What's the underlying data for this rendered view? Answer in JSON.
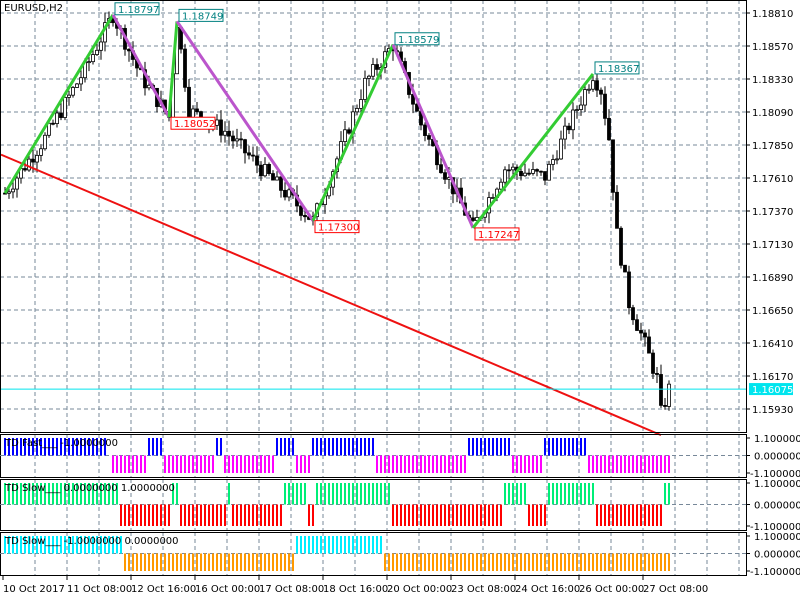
{
  "chart_data": {
    "type": "candlestick",
    "title": "EURUSD,H2",
    "price_ticks": [
      "1.18810",
      "1.18570",
      "1.18330",
      "1.18090",
      "1.17850",
      "1.17610",
      "1.17370",
      "1.17130",
      "1.16890",
      "1.16650",
      "1.16410",
      "1.16170",
      "1.15930"
    ],
    "price_range": [
      1.1562,
      1.1893
    ],
    "current_price": "1.16075",
    "time_labels": [
      "10 Oct 2017",
      "11 Oct 08:00",
      "12 Oct 16:00",
      "16 Oct 00:00",
      "17 Oct 08:00",
      "18 Oct 16:00",
      "20 Oct 00:00",
      "23 Oct 08:00",
      "24 Oct 16:00",
      "26 Oct 00:00",
      "27 Oct 08:00"
    ],
    "bar_count": 167,
    "price_path": [
      [
        0,
        1.175
      ],
      [
        10,
        1.179
      ],
      [
        20,
        1.184
      ],
      [
        27,
        1.18797
      ],
      [
        34,
        1.1835
      ],
      [
        41,
        1.18052
      ],
      [
        43,
        1.18749
      ],
      [
        46,
        1.181
      ],
      [
        55,
        1.1795
      ],
      [
        65,
        1.1765
      ],
      [
        77,
        1.173
      ],
      [
        83,
        1.1775
      ],
      [
        90,
        1.183
      ],
      [
        97,
        1.18579
      ],
      [
        104,
        1.18
      ],
      [
        110,
        1.1765
      ],
      [
        117,
        1.17247
      ],
      [
        125,
        1.1768
      ],
      [
        135,
        1.1762
      ],
      [
        147,
        1.18367
      ],
      [
        149,
        1.1825
      ],
      [
        151,
        1.179
      ],
      [
        153,
        1.172
      ],
      [
        156,
        1.167
      ],
      [
        160,
        1.164
      ],
      [
        163,
        1.1615
      ],
      [
        164,
        1.159
      ],
      [
        166,
        1.16075
      ]
    ],
    "zigzag": [
      {
        "bar": 0,
        "price": 1.175
      },
      {
        "bar": 27,
        "price": 1.18797,
        "label": "1.18797"
      },
      {
        "bar": 41,
        "price": 1.18052,
        "label": "1.18052"
      },
      {
        "bar": 43,
        "price": 1.18749,
        "label": "1.18749"
      },
      {
        "bar": 77,
        "price": 1.173,
        "label": "1.17300"
      },
      {
        "bar": 97,
        "price": 1.18579,
        "label": "1.18579"
      },
      {
        "bar": 117,
        "price": 1.17247,
        "label": "1.17247"
      },
      {
        "bar": 147,
        "price": 1.18367,
        "label": "1.18367"
      }
    ],
    "trendline": [
      {
        "bar": -1,
        "price": 1.1778
      },
      {
        "bar": 164,
        "price": 1.1574
      }
    ],
    "panels": [
      {
        "name": "TD Fast",
        "label": "TD Fast___ -1.0000000",
        "pos": "#0000ff",
        "neg": "#ff00ff",
        "ticks": [
          "1.1000000",
          "0.0000000",
          "-1.1000000"
        ],
        "runs": [
          [
            0,
            25,
            1
          ],
          [
            27,
            35,
            -1
          ],
          [
            36,
            39,
            1
          ],
          [
            40,
            52,
            -1
          ],
          [
            53,
            54,
            1
          ],
          [
            55,
            67,
            -1
          ],
          [
            68,
            72,
            1
          ],
          [
            73,
            76,
            -1
          ],
          [
            77,
            92,
            1
          ],
          [
            93,
            115,
            -1
          ],
          [
            116,
            126,
            1
          ],
          [
            127,
            134,
            -1
          ],
          [
            135,
            145,
            1
          ],
          [
            146,
            166,
            -1
          ]
        ]
      },
      {
        "name": "TD Slow 1",
        "label": "TD Slow___ 0.0000000 1.0000000",
        "pos": "#00ee77",
        "neg": "#ff0000",
        "ticks": [
          "1.1000000",
          "0.0000000",
          "-1.1000000"
        ],
        "runs": [
          [
            0,
            28,
            1
          ],
          [
            29,
            41,
            -1
          ],
          [
            42,
            43,
            1
          ],
          [
            44,
            55,
            -1
          ],
          [
            56,
            56,
            1
          ],
          [
            57,
            69,
            -1
          ],
          [
            70,
            75,
            1
          ],
          [
            76,
            77,
            -1
          ],
          [
            78,
            96,
            1
          ],
          [
            97,
            124,
            -1
          ],
          [
            125,
            130,
            1
          ],
          [
            131,
            135,
            -1
          ],
          [
            136,
            147,
            1
          ],
          [
            148,
            164,
            -1
          ],
          [
            165,
            166,
            1
          ]
        ]
      },
      {
        "name": "TD Slow 2",
        "label": "TD Slow___ -1.0000000 0.0000000",
        "pos": "#00eeff",
        "neg": "#ff9900",
        "ticks": [
          "1.1000000",
          "0.0000000",
          "-1.1000000"
        ],
        "runs": [
          [
            0,
            29,
            1
          ],
          [
            30,
            72,
            -1
          ],
          [
            73,
            94,
            1
          ],
          [
            95,
            166,
            -1
          ]
        ]
      }
    ]
  },
  "colors": {
    "grid": "#778899",
    "up_leg": "#33cc33",
    "down_leg": "#bb55cc",
    "trend": "#ee1111",
    "price_line": "#00e5ee"
  }
}
